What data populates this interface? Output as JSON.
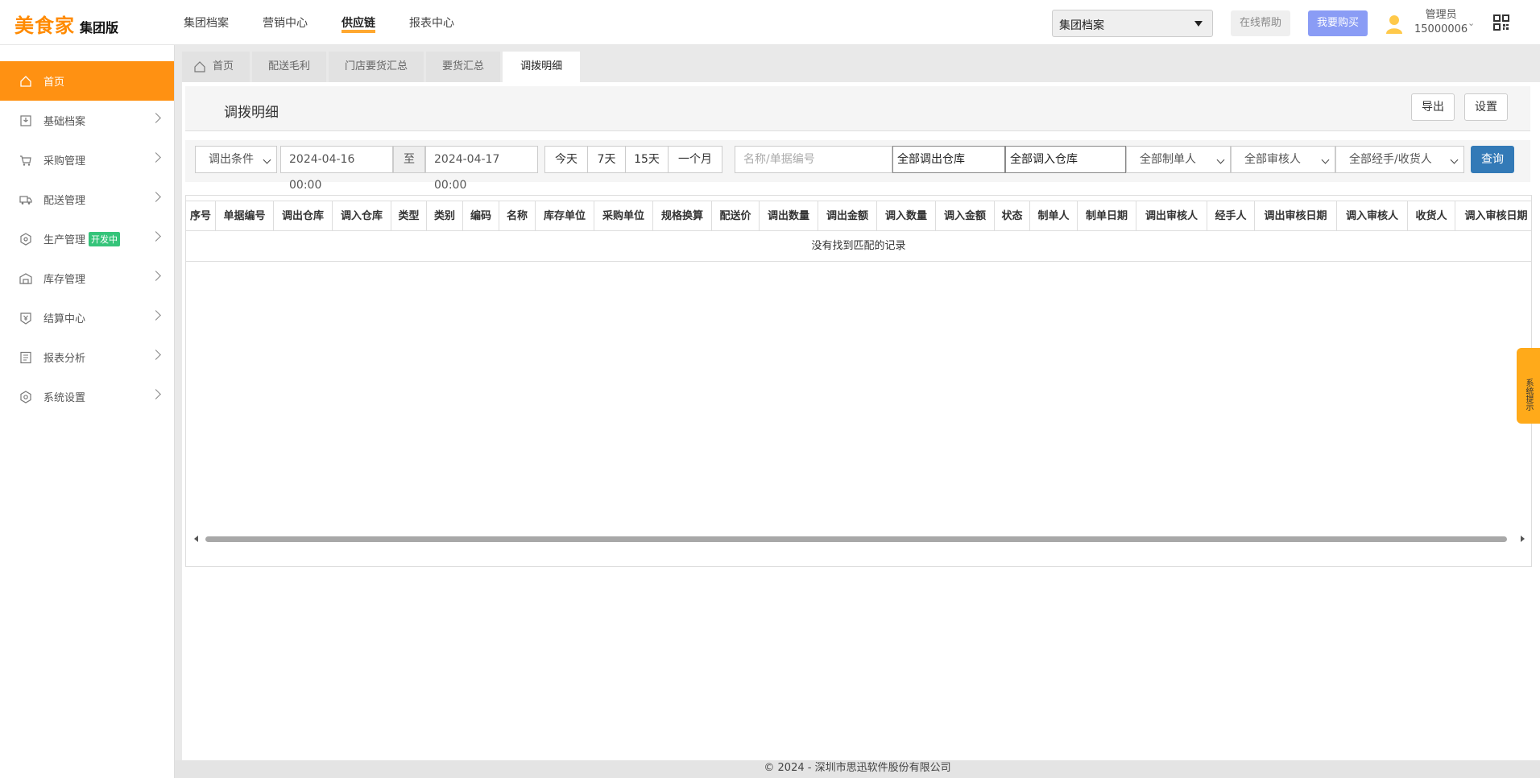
{
  "app": {
    "logo_main": "美食家",
    "logo_sub": "集团版"
  },
  "topnav": [
    {
      "label": "集团档案"
    },
    {
      "label": "营销中心"
    },
    {
      "label": "供应链",
      "active": true
    },
    {
      "label": "报表中心"
    }
  ],
  "header": {
    "select_value": "集团档案",
    "help_label": "在线帮助",
    "buy_label": "我要购买",
    "user_role": "管理员",
    "user_id": "15000006"
  },
  "sidebar": {
    "items": [
      {
        "label": "首页",
        "icon": "home-icon"
      },
      {
        "label": "基础档案",
        "icon": "archive-icon"
      },
      {
        "label": "采购管理",
        "icon": "cart-icon"
      },
      {
        "label": "配送管理",
        "icon": "truck-icon"
      },
      {
        "label": "生产管理",
        "icon": "production-icon",
        "badge": "开发中"
      },
      {
        "label": "库存管理",
        "icon": "warehouse-icon"
      },
      {
        "label": "结算中心",
        "icon": "settlement-icon"
      },
      {
        "label": "报表分析",
        "icon": "report-icon"
      },
      {
        "label": "系统设置",
        "icon": "settings-icon"
      }
    ]
  },
  "tabs": [
    {
      "label": "首页"
    },
    {
      "label": "配送毛利"
    },
    {
      "label": "门店要货汇总"
    },
    {
      "label": "要货汇总"
    },
    {
      "label": "调拨明细",
      "active": true
    }
  ],
  "page": {
    "title": "调拨明细",
    "export_label": "导出",
    "settings_label": "设置"
  },
  "filters": {
    "condition": "调出条件",
    "date_from": "2024-04-16 00:00",
    "to_label": "至",
    "date_to": "2024-04-17 00:00",
    "quick": [
      "今天",
      "7天",
      "15天",
      "一个月"
    ],
    "search_placeholder": "名称/单据编号",
    "out_warehouse": "全部调出仓库",
    "in_warehouse": "全部调入仓库",
    "creator": "全部制单人",
    "auditor": "全部审核人",
    "handler": "全部经手/收货人",
    "query_label": "查询"
  },
  "table": {
    "columns": [
      "序号",
      "单据编号",
      "调出仓库",
      "调入仓库",
      "类型",
      "类别",
      "编码",
      "名称",
      "库存单位",
      "采购单位",
      "规格换算",
      "配送价",
      "调出数量",
      "调出金额",
      "调入数量",
      "调入金额",
      "状态",
      "制单人",
      "制单日期",
      "调出审核人",
      "经手人",
      "调出审核日期",
      "调入审核人",
      "收货人",
      "调入审核日期"
    ],
    "empty_text": "没有找到匹配的记录"
  },
  "footer": {
    "text": "© 2024 - 深圳市思迅软件股份有限公司"
  },
  "sys_tip": "系统提示"
}
